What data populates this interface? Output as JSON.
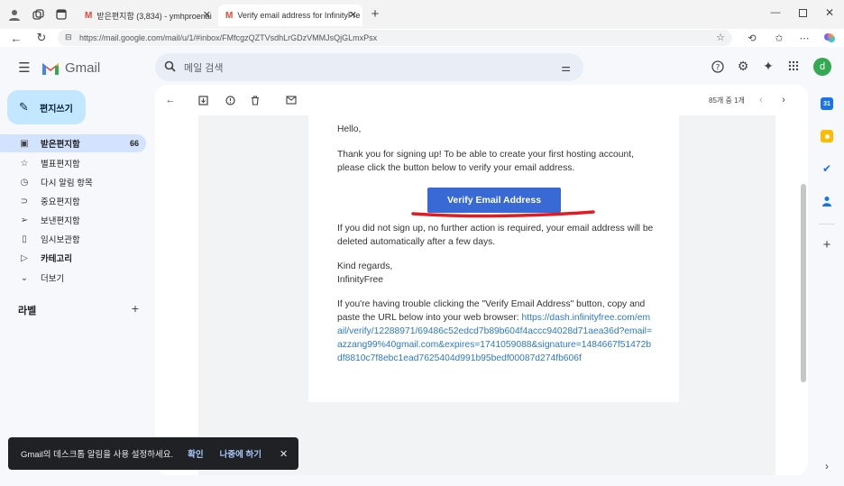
{
  "browser": {
    "tabs": [
      {
        "title": "받은편지함 (3,834) - ymhproenai",
        "active": false
      },
      {
        "title": "Verify email address for InfinityFre",
        "active": true
      }
    ],
    "url": "https://mail.google.com/mail/u/1/#inbox/FMfcgzQZTVsdhLrGDzVMMJsQjGLmxPsx",
    "url_domain": "mail.google.com"
  },
  "gmail": {
    "logo_text": "Gmail",
    "search_placeholder": "메일 검색",
    "avatar_letter": "d",
    "compose_label": "편지쓰기",
    "nav": [
      {
        "label": "받은편지함",
        "count": "66",
        "active": true,
        "icon": "inbox-icon",
        "glyph": "▣"
      },
      {
        "label": "별표편지함",
        "count": "",
        "active": false,
        "icon": "star-icon",
        "glyph": "☆"
      },
      {
        "label": "다시 알림 항목",
        "count": "",
        "active": false,
        "icon": "clock-icon",
        "glyph": "◷"
      },
      {
        "label": "중요편지함",
        "count": "",
        "active": false,
        "icon": "important-icon",
        "glyph": "⊃"
      },
      {
        "label": "보낸편지함",
        "count": "",
        "active": false,
        "icon": "send-icon",
        "glyph": "➢"
      },
      {
        "label": "임시보관함",
        "count": "",
        "active": false,
        "icon": "draft-icon",
        "glyph": "▯"
      },
      {
        "label": "카테고리",
        "count": "",
        "active": false,
        "icon": "label-icon",
        "glyph": "▷",
        "bold": true
      },
      {
        "label": "더보기",
        "count": "",
        "active": false,
        "icon": "chevron-down-icon",
        "glyph": "⌄"
      }
    ],
    "labels_heading": "라벨",
    "pagination": "85개 중 1개",
    "email": {
      "greeting": "Hello,",
      "para1": "Thank you for signing up! To be able to create your first hosting account, please click the button below to verify your email address.",
      "button_label": "Verify Email Address",
      "para2": "If you did not sign up, no further action is required, your email address will be deleted automatically after a few days.",
      "regards": "Kind regards,",
      "signature": "InfinityFree",
      "para3_text": "If you're having trouble clicking the \"Verify Email Address\" button, copy and paste the URL below into your web browser: ",
      "para3_link": "https://dash.infinityfree.com/email/verify/12288971/69486c52edcd7b89b604f4accc94028d71aea36d?email=azzang99%40gmail.com&expires=1741059088&signature=1484667f51472bdf8810c7f8ebc1ead7625404d991b95bedf00087d274fb606f"
    },
    "snackbar": {
      "message": "Gmail의 데스크톱 알림을 사용 설정하세요.",
      "confirm": "확인",
      "later": "나중에 하기"
    }
  },
  "colors": {
    "accent": "#3869d4",
    "link": "#2b79c8",
    "annotation_red": "#e21b23",
    "nav_active_bg": "#d3e3fd",
    "compose_bg": "#c2e7ff"
  }
}
